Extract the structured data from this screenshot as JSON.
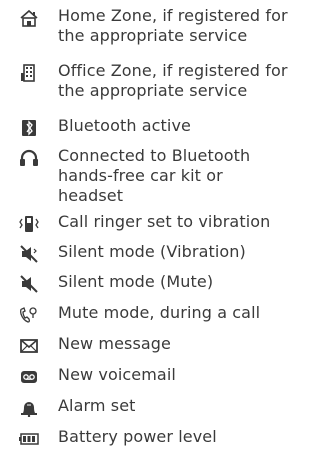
{
  "items": [
    {
      "icon": "home-zone-icon",
      "label": "Home Zone, if registered for\nthe appropriate service"
    },
    {
      "icon": "office-zone-icon",
      "label": "Office Zone, if registered for\nthe appropriate service"
    },
    {
      "icon": "bluetooth-icon",
      "label": "Bluetooth active"
    },
    {
      "icon": "headset-icon",
      "label": "Connected to Bluetooth\nhands-free car kit or\nheadset"
    },
    {
      "icon": "vibration-icon",
      "label": "Call ringer set to vibration"
    },
    {
      "icon": "silent-vibration-icon",
      "label": "Silent mode (Vibration)"
    },
    {
      "icon": "silent-mute-icon",
      "label": "Silent mode (Mute)"
    },
    {
      "icon": "mute-call-icon",
      "label": "Mute mode, during a call"
    },
    {
      "icon": "envelope-icon",
      "label": "New message"
    },
    {
      "icon": "voicemail-icon",
      "label": "New voicemail"
    },
    {
      "icon": "alarm-icon",
      "label": "Alarm set"
    },
    {
      "icon": "battery-icon",
      "label": "Battery power level"
    }
  ]
}
